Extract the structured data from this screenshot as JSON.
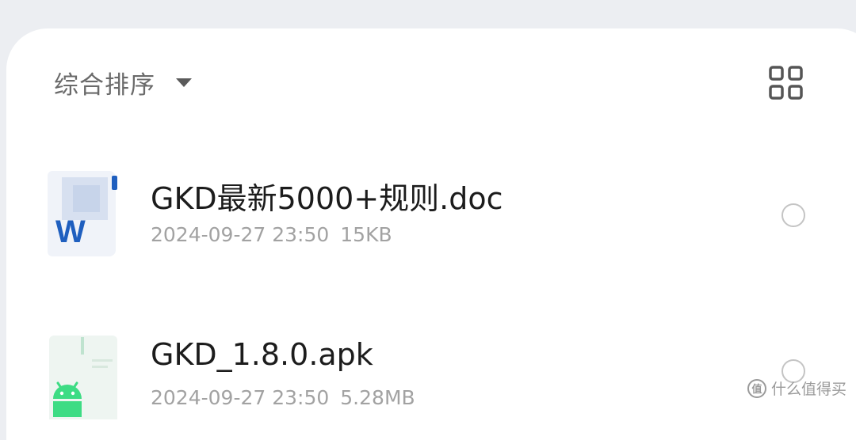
{
  "sort": {
    "label": "综合排序"
  },
  "files": [
    {
      "name": "GKD最新5000+规则.doc",
      "date": "2024-09-27 23:50",
      "size": "15KB",
      "icon": "word-doc-icon",
      "icon_letter": "W"
    },
    {
      "name": "GKD_1.8.0.apk",
      "date": "2024-09-27 23:50",
      "size": "5.28MB",
      "icon": "apk-android-icon"
    }
  ],
  "watermark": {
    "badge": "值",
    "text": "什么值得买"
  },
  "colors": {
    "background": "#eceef2",
    "sheet": "#ffffff",
    "word_blue": "#1f5fbf",
    "android_green": "#3ddc84"
  }
}
